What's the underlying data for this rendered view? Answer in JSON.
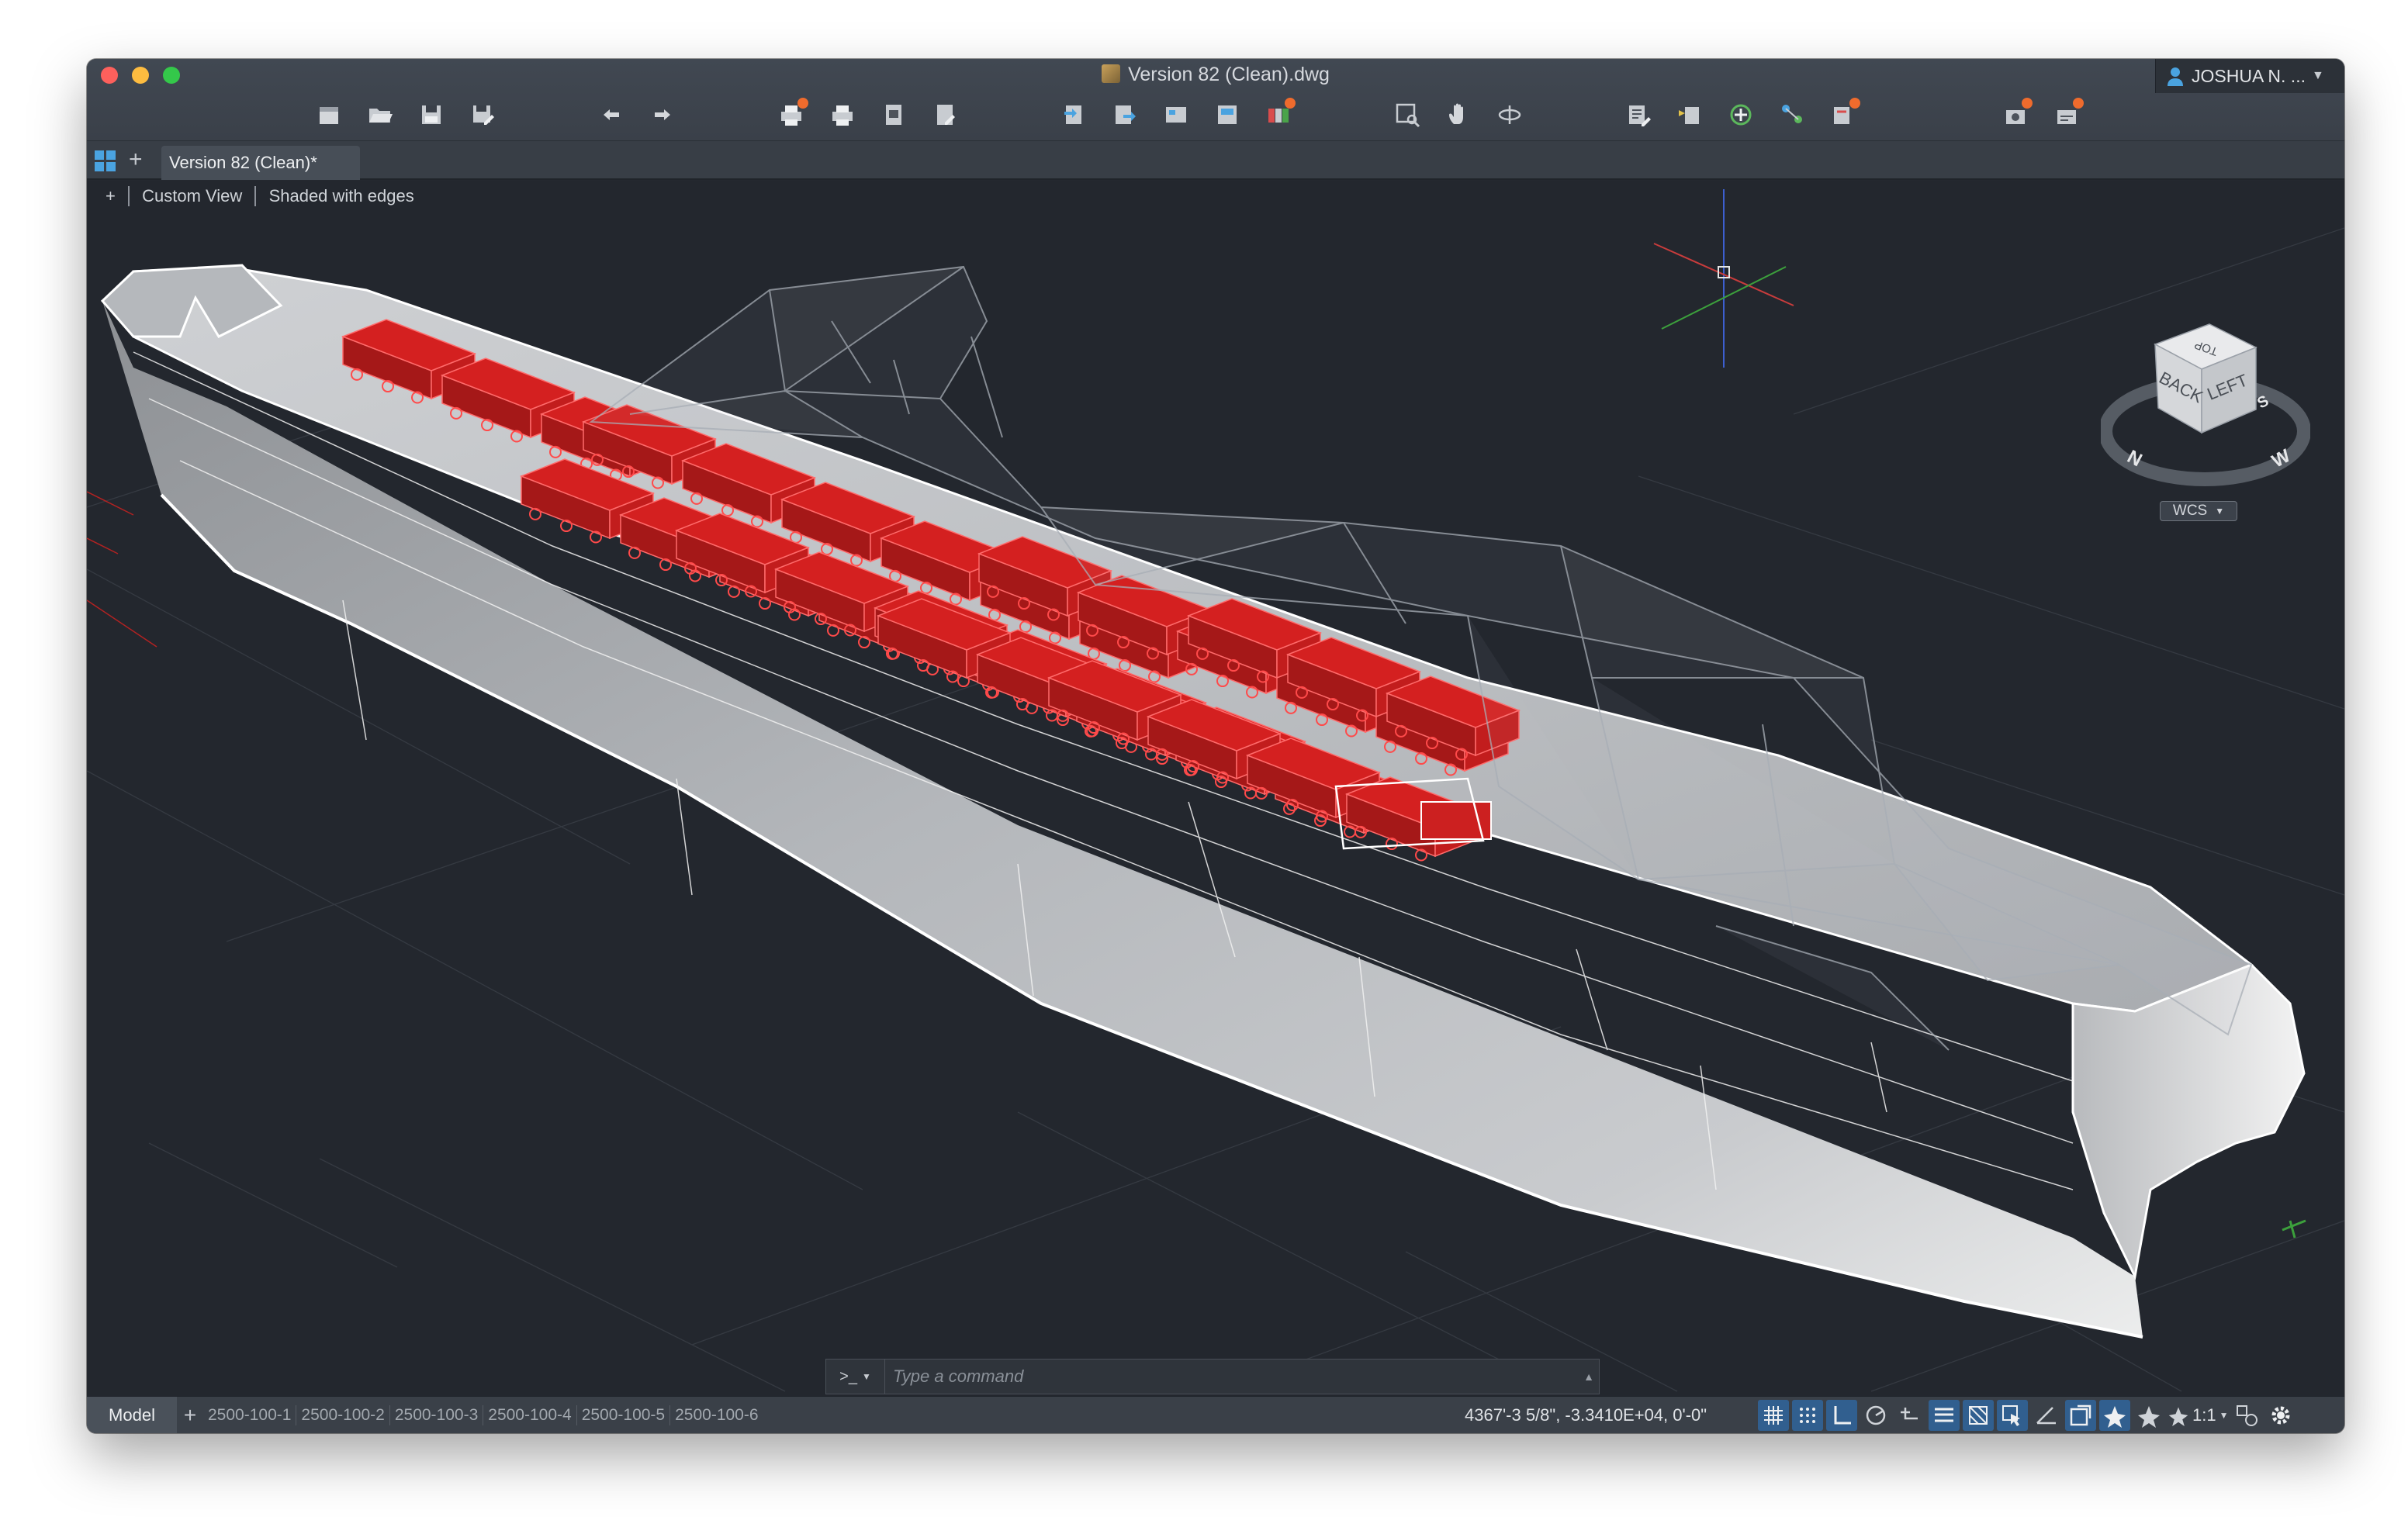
{
  "window": {
    "title": "Version 82 (Clean).dwg",
    "user": "JOSHUA N. ...",
    "traffic_colors": [
      "#fc605c",
      "#fdbc40",
      "#34c84a"
    ]
  },
  "toolbar": {
    "groups": [
      [
        "new-file-icon",
        "open-folder-icon",
        "save-icon",
        "save-as-icon"
      ],
      [
        "undo-icon",
        "redo-icon"
      ],
      [
        "plot-icon",
        "print-icon",
        "page-setup-icon",
        "publish-icon"
      ],
      [
        "import-icon",
        "export-icon",
        "xref-icon",
        "reference-manager-icon",
        "render-icon"
      ],
      [
        "zoom-window-icon",
        "pan-icon",
        "orbit-icon"
      ],
      [
        "properties-icon",
        "layer-manager-icon",
        "design-center-icon",
        "block-icon",
        "measure-icon"
      ],
      [
        "settings-badge-icon",
        "workspace-badge-icon"
      ]
    ]
  },
  "tabs": {
    "active_label": "Version 82 (Clean)*"
  },
  "viewport": {
    "controls": {
      "plus": "+",
      "view": "Custom View",
      "visual_style": "Shaded with edges"
    },
    "viewcube": {
      "faces": [
        "TOP",
        "BACK",
        "LEFT"
      ],
      "compass": [
        "N",
        "W",
        "S"
      ]
    },
    "ucs_label": "WCS",
    "model_colors": {
      "hull": "#b9bcc0",
      "cargo": "#d42020",
      "wireframe": "#aab0b8",
      "background": "#23272e"
    }
  },
  "command": {
    "prompt": ">_",
    "placeholder": "Type a command"
  },
  "status": {
    "model_tab": "Model",
    "layouts": [
      "2500-100-1",
      "2500-100-2",
      "2500-100-3",
      "2500-100-4",
      "2500-100-5",
      "2500-100-6"
    ],
    "coordinates": "4367'-3 5/8\", -3.3410E+04, 0'-0\"",
    "annotation_scale": "1:1"
  }
}
